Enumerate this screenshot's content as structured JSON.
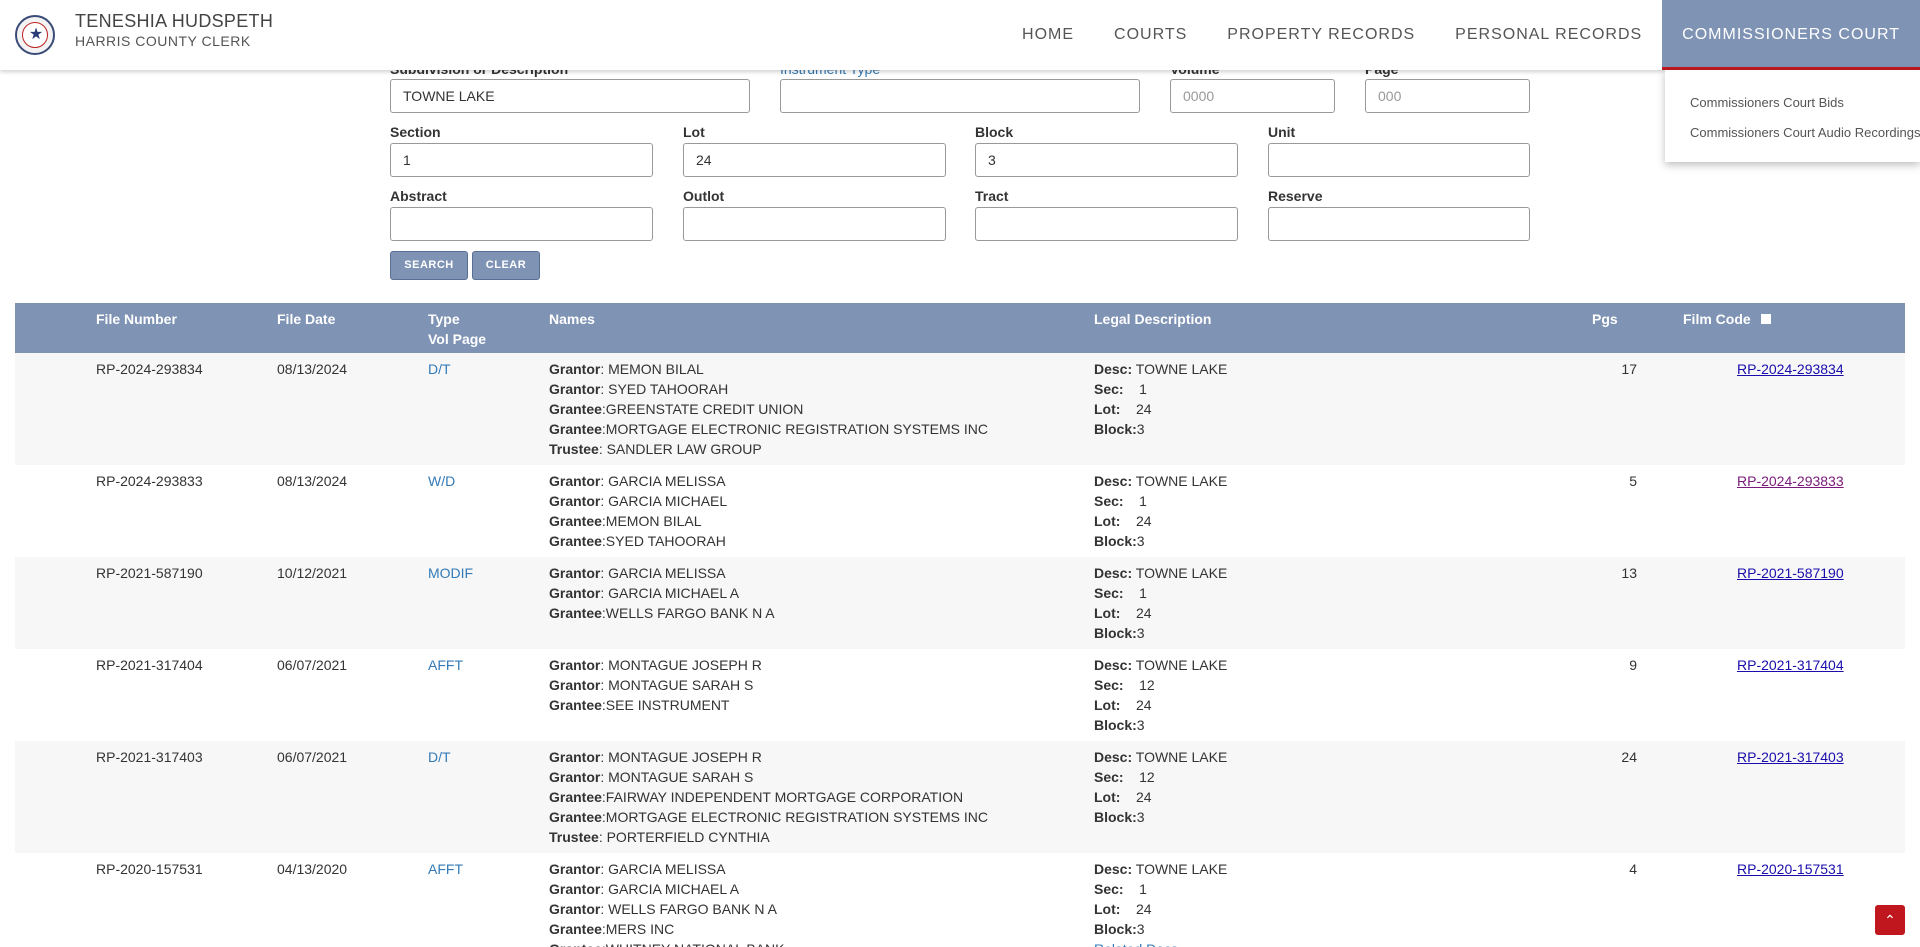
{
  "header": {
    "brand_name": "TENESHIA HUDSPETH",
    "brand_sub": "HARRIS COUNTY CLERK",
    "nav": [
      "HOME",
      "COURTS",
      "PROPERTY RECORDS",
      "PERSONAL RECORDS",
      "COMMISSIONERS COURT"
    ],
    "dropdown": [
      "Commissioners Court Bids",
      "Commissioners Court Audio Recordings"
    ],
    "accent_color": "#7f93b5",
    "active_underline_color": "#c0171f"
  },
  "form": {
    "subdivision_label": "Subdivision or Description",
    "subdivision_value": "TOWNE LAKE",
    "instrument_label": "Instrument Type",
    "volume_label": "Volume",
    "volume_placeholder": "0000",
    "page_label": "Page",
    "page_placeholder": "000",
    "section_label": "Section",
    "section_value": "1",
    "lot_label": "Lot",
    "lot_value": "24",
    "block_label": "Block",
    "block_value": "3",
    "unit_label": "Unit",
    "abstract_label": "Abstract",
    "outlot_label": "Outlot",
    "tract_label": "Tract",
    "reserve_label": "Reserve",
    "search_label": "SEARCH",
    "clear_label": "CLEAR"
  },
  "table": {
    "headers": {
      "file_number": "File Number",
      "file_date": "File Date",
      "type": "Type",
      "vol_page": "Vol Page",
      "names": "Names",
      "legal": "Legal Description",
      "pgs": "Pgs",
      "film_code": "Film Code"
    },
    "rows": [
      {
        "file_number": "RP-2024-293834",
        "file_date": "08/13/2024",
        "type": "D/T",
        "names": [
          [
            "Grantor",
            ": MEMON BILAL"
          ],
          [
            "Grantor",
            ": SYED TAHOORAH"
          ],
          [
            "Grantee",
            ":GREENSTATE CREDIT UNION"
          ],
          [
            "Grantee",
            ":MORTGAGE ELECTRONIC REGISTRATION SYSTEMS INC"
          ],
          [
            "Trustee",
            ": SANDLER LAW GROUP"
          ]
        ],
        "legal": [
          [
            "Desc:",
            " TOWNE LAKE"
          ],
          [
            "Sec:",
            "    1"
          ],
          [
            "Lot:",
            "    24"
          ],
          [
            "Block:",
            "3"
          ]
        ],
        "pgs": "17",
        "film_code": "RP-2024-293834",
        "film_visited": false,
        "related": ""
      },
      {
        "file_number": "RP-2024-293833",
        "file_date": "08/13/2024",
        "type": "W/D",
        "names": [
          [
            "Grantor",
            ": GARCIA MELISSA"
          ],
          [
            "Grantor",
            ": GARCIA MICHAEL"
          ],
          [
            "Grantee",
            ":MEMON BILAL"
          ],
          [
            "Grantee",
            ":SYED TAHOORAH"
          ]
        ],
        "legal": [
          [
            "Desc:",
            " TOWNE LAKE"
          ],
          [
            "Sec:",
            "    1"
          ],
          [
            "Lot:",
            "    24"
          ],
          [
            "Block:",
            "3"
          ]
        ],
        "pgs": "5",
        "film_code": "RP-2024-293833",
        "film_visited": true,
        "related": ""
      },
      {
        "file_number": "RP-2021-587190",
        "file_date": "10/12/2021",
        "type": "MODIF",
        "names": [
          [
            "Grantor",
            ": GARCIA MELISSA"
          ],
          [
            "Grantor",
            ": GARCIA MICHAEL A"
          ],
          [
            "Grantee",
            ":WELLS FARGO BANK N A"
          ]
        ],
        "legal": [
          [
            "Desc:",
            " TOWNE LAKE"
          ],
          [
            "Sec:",
            "    1"
          ],
          [
            "Lot:",
            "    24"
          ],
          [
            "Block:",
            "3"
          ]
        ],
        "pgs": "13",
        "film_code": "RP-2021-587190",
        "film_visited": false,
        "related": ""
      },
      {
        "file_number": "RP-2021-317404",
        "file_date": "06/07/2021",
        "type": "AFFT",
        "names": [
          [
            "Grantor",
            ": MONTAGUE JOSEPH R"
          ],
          [
            "Grantor",
            ": MONTAGUE SARAH S"
          ],
          [
            "Grantee",
            ":SEE INSTRUMENT"
          ]
        ],
        "legal": [
          [
            "Desc:",
            " TOWNE LAKE"
          ],
          [
            "Sec:",
            "    12"
          ],
          [
            "Lot:",
            "    24"
          ],
          [
            "Block:",
            "3"
          ]
        ],
        "pgs": "9",
        "film_code": "RP-2021-317404",
        "film_visited": false,
        "related": ""
      },
      {
        "file_number": "RP-2021-317403",
        "file_date": "06/07/2021",
        "type": "D/T",
        "names": [
          [
            "Grantor",
            ": MONTAGUE JOSEPH R"
          ],
          [
            "Grantor",
            ": MONTAGUE SARAH S"
          ],
          [
            "Grantee",
            ":FAIRWAY INDEPENDENT MORTGAGE CORPORATION"
          ],
          [
            "Grantee",
            ":MORTGAGE ELECTRONIC REGISTRATION SYSTEMS INC"
          ],
          [
            "Trustee",
            ": PORTERFIELD CYNTHIA"
          ]
        ],
        "legal": [
          [
            "Desc:",
            " TOWNE LAKE"
          ],
          [
            "Sec:",
            "    12"
          ],
          [
            "Lot:",
            "    24"
          ],
          [
            "Block:",
            "3"
          ]
        ],
        "pgs": "24",
        "film_code": "RP-2021-317403",
        "film_visited": false,
        "related": ""
      },
      {
        "file_number": "RP-2020-157531",
        "file_date": "04/13/2020",
        "type": "AFFT",
        "names": [
          [
            "Grantor",
            ": GARCIA MELISSA"
          ],
          [
            "Grantor",
            ": GARCIA MICHAEL A"
          ],
          [
            "Grantor",
            ": WELLS FARGO BANK N A"
          ],
          [
            "Grantee",
            ":MERS INC"
          ],
          [
            "Grantee",
            ":WHITNEY NATIONAL BANK"
          ]
        ],
        "legal": [
          [
            "Desc:",
            " TOWNE LAKE"
          ],
          [
            "Sec:",
            "    1"
          ],
          [
            "Lot:",
            "    24"
          ],
          [
            "Block:",
            "3"
          ]
        ],
        "pgs": "4",
        "film_code": "RP-2020-157531",
        "film_visited": false,
        "related": "Related Docs"
      }
    ]
  }
}
